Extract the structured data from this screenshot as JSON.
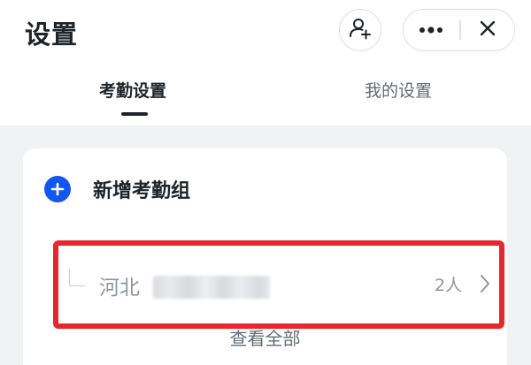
{
  "header": {
    "title": "设置",
    "add_user_icon": "add-user-icon",
    "more_icon": "more-dots-icon",
    "close_icon": "close-icon"
  },
  "tabs": [
    {
      "label": "考勤设置",
      "active": true
    },
    {
      "label": "我的设置",
      "active": false
    }
  ],
  "attendance": {
    "add_group_label": "新增考勤组",
    "groups": [
      {
        "name": "河北",
        "member_count": "2人"
      }
    ],
    "view_all_label": "查看全部"
  },
  "colors": {
    "accent": "#1456f0",
    "highlight_border": "#e8262d",
    "text_primary": "#1f2329",
    "text_secondary": "#8f959e",
    "content_background": "#f1f2f4"
  }
}
